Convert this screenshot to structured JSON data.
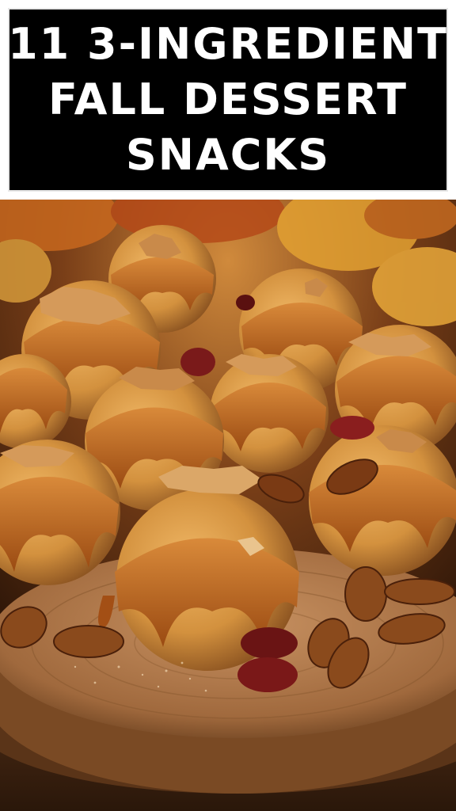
{
  "title": {
    "line1": "11 3-INGREDIENT",
    "line2": "FALL DESSERT",
    "line3": "SNACKS"
  },
  "photo": {
    "subject": "caramel-drizzled-pumpkin-balls-on-wood-slice"
  },
  "colors": {
    "banner_bg": "#000000",
    "banner_text": "#ffffff",
    "frame": "#ffffff",
    "caramel": "#b8611c",
    "ball": "#d9963f",
    "wood": "#a77247"
  }
}
